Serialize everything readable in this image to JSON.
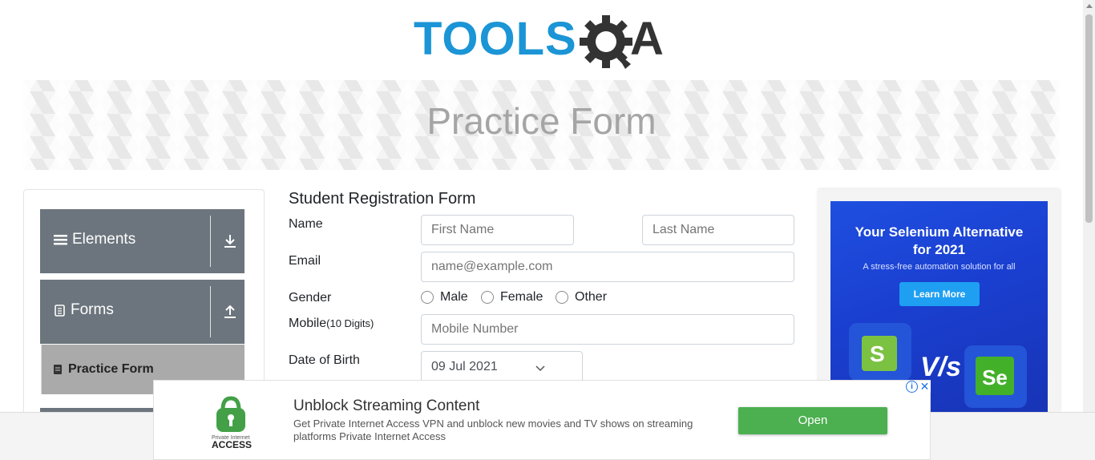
{
  "header": {
    "logo_text_left": "TOOLS",
    "logo_text_right": "A"
  },
  "banner": {
    "title": "Practice Form"
  },
  "sidebar": {
    "groups": [
      {
        "label": "Elements",
        "icon": "hamburger-icon",
        "toggle_icon": "download-arrow-icon"
      },
      {
        "label": "Forms",
        "icon": "document-icon",
        "toggle_icon": "upload-arrow-icon"
      }
    ],
    "active_item": {
      "label": "Practice Form",
      "icon": "form-icon"
    }
  },
  "form": {
    "title": "Student Registration Form",
    "name_label": "Name",
    "first_name_placeholder": "First Name",
    "last_name_placeholder": "Last Name",
    "email_label": "Email",
    "email_placeholder": "name@example.com",
    "gender_label": "Gender",
    "gender_options": [
      "Male",
      "Female",
      "Other"
    ],
    "mobile_label": "Mobile",
    "mobile_hint": "(10 Digits)",
    "mobile_placeholder": "Mobile Number",
    "dob_label": "Date of Birth",
    "dob_value": "09 Jul 2021"
  },
  "right_ad": {
    "title_line1": "Your Selenium Alternative",
    "title_line2": "for 2021",
    "subtitle": "A stress-free automation solution for all",
    "button": "Learn More",
    "vs_text": "V/s",
    "se_text": "Se"
  },
  "bottom_ad": {
    "logo_line1": "Private Internet",
    "logo_line2": "ACCESS",
    "headline": "Unblock Streaming Content",
    "description": "Get Private Internet Access VPN and unblock new movies and TV shows on streaming platforms Private Internet Access",
    "button": "Open",
    "info_icon": "info-icon",
    "close_icon": "close-icon"
  },
  "colors": {
    "tools_blue": "#1b95d6",
    "gear_dark": "#333333",
    "sidebar_gray": "#6c757d",
    "open_green": "#4caf50"
  }
}
